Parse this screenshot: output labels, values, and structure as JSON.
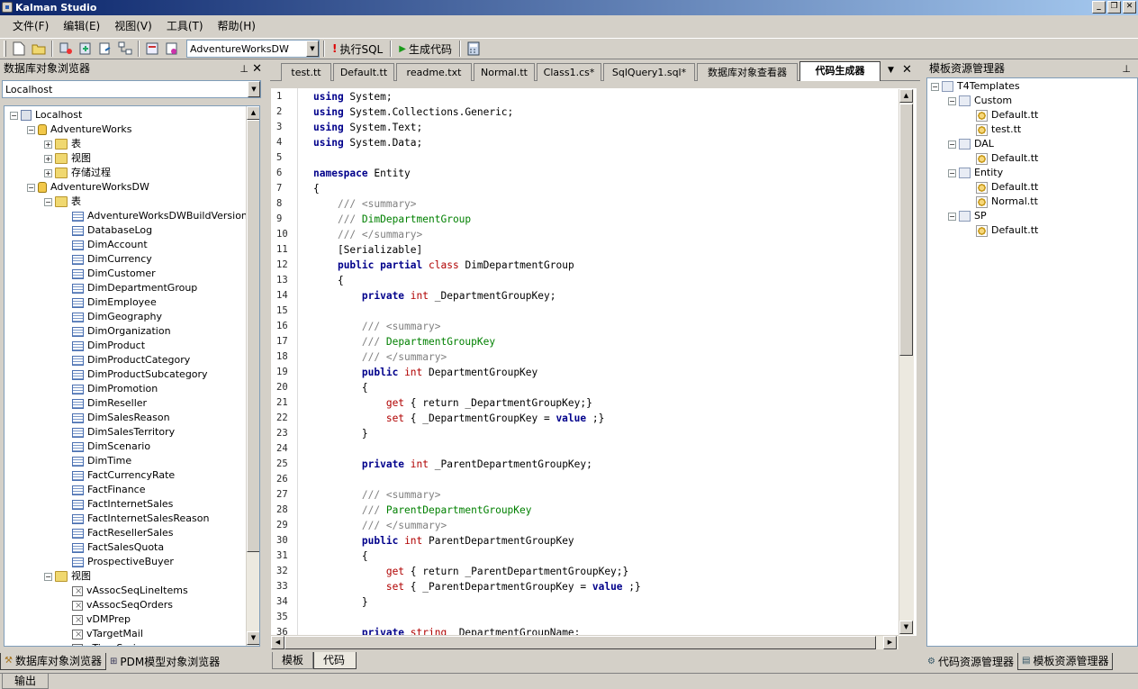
{
  "window": {
    "title": "Kalman Studio"
  },
  "menu": [
    "文件(F)",
    "编辑(E)",
    "视图(V)",
    "工具(T)",
    "帮助(H)"
  ],
  "toolbar": {
    "database": "AdventureWorksDW",
    "exec_sql": "执行SQL",
    "gen_code": "生成代码"
  },
  "left_panel": {
    "title": "数据库对象浏览器",
    "server_combo": "Localhost",
    "tree": [
      {
        "label": "Localhost",
        "level": 0,
        "icon": "server-icon",
        "exp": "-"
      },
      {
        "label": "AdventureWorks",
        "level": 1,
        "icon": "database-icon",
        "exp": "-"
      },
      {
        "label": "表",
        "level": 2,
        "icon": "folder-icon",
        "exp": "+"
      },
      {
        "label": "视图",
        "level": 2,
        "icon": "folder-icon",
        "exp": "+"
      },
      {
        "label": "存储过程",
        "level": 2,
        "icon": "folder-icon",
        "exp": "+"
      },
      {
        "label": "AdventureWorksDW",
        "level": 1,
        "icon": "database-icon",
        "exp": "-"
      },
      {
        "label": "表",
        "level": 2,
        "icon": "folder-icon",
        "exp": "-"
      },
      {
        "label": "AdventureWorksDWBuildVersion",
        "level": 3,
        "icon": "table-icon"
      },
      {
        "label": "DatabaseLog",
        "level": 3,
        "icon": "table-icon"
      },
      {
        "label": "DimAccount",
        "level": 3,
        "icon": "table-icon"
      },
      {
        "label": "DimCurrency",
        "level": 3,
        "icon": "table-icon"
      },
      {
        "label": "DimCustomer",
        "level": 3,
        "icon": "table-icon"
      },
      {
        "label": "DimDepartmentGroup",
        "level": 3,
        "icon": "table-icon"
      },
      {
        "label": "DimEmployee",
        "level": 3,
        "icon": "table-icon"
      },
      {
        "label": "DimGeography",
        "level": 3,
        "icon": "table-icon"
      },
      {
        "label": "DimOrganization",
        "level": 3,
        "icon": "table-icon"
      },
      {
        "label": "DimProduct",
        "level": 3,
        "icon": "table-icon"
      },
      {
        "label": "DimProductCategory",
        "level": 3,
        "icon": "table-icon"
      },
      {
        "label": "DimProductSubcategory",
        "level": 3,
        "icon": "table-icon"
      },
      {
        "label": "DimPromotion",
        "level": 3,
        "icon": "table-icon"
      },
      {
        "label": "DimReseller",
        "level": 3,
        "icon": "table-icon"
      },
      {
        "label": "DimSalesReason",
        "level": 3,
        "icon": "table-icon"
      },
      {
        "label": "DimSalesTerritory",
        "level": 3,
        "icon": "table-icon"
      },
      {
        "label": "DimScenario",
        "level": 3,
        "icon": "table-icon"
      },
      {
        "label": "DimTime",
        "level": 3,
        "icon": "table-icon"
      },
      {
        "label": "FactCurrencyRate",
        "level": 3,
        "icon": "table-icon"
      },
      {
        "label": "FactFinance",
        "level": 3,
        "icon": "table-icon"
      },
      {
        "label": "FactInternetSales",
        "level": 3,
        "icon": "table-icon"
      },
      {
        "label": "FactInternetSalesReason",
        "level": 3,
        "icon": "table-icon"
      },
      {
        "label": "FactResellerSales",
        "level": 3,
        "icon": "table-icon"
      },
      {
        "label": "FactSalesQuota",
        "level": 3,
        "icon": "table-icon"
      },
      {
        "label": "ProspectiveBuyer",
        "level": 3,
        "icon": "table-icon"
      },
      {
        "label": "视图",
        "level": 2,
        "icon": "folder-icon",
        "exp": "-"
      },
      {
        "label": "vAssocSeqLineItems",
        "level": 3,
        "icon": "view-icon"
      },
      {
        "label": "vAssocSeqOrders",
        "level": 3,
        "icon": "view-icon"
      },
      {
        "label": "vDMPrep",
        "level": 3,
        "icon": "view-icon"
      },
      {
        "label": "vTargetMail",
        "level": 3,
        "icon": "view-icon"
      },
      {
        "label": "vTimeSeries",
        "level": 3,
        "icon": "view-icon"
      }
    ],
    "bottom_tabs": [
      "数据库对象浏览器",
      "PDM模型对象浏览器"
    ]
  },
  "doc_tabs": [
    "test.tt",
    "Default.tt",
    "readme.txt",
    "Normal.tt",
    "Class1.cs*",
    "SqlQuery1.sql*",
    "数据库对象查看器",
    "代码生成器"
  ],
  "active_doc_tab": "代码生成器",
  "editor": {
    "lines": [
      [
        [
          "kw",
          "using"
        ],
        [
          "",
          "System;"
        ]
      ],
      [
        [
          "kw",
          "using"
        ],
        [
          "",
          "System.Collections.Generic;"
        ]
      ],
      [
        [
          "kw",
          "using"
        ],
        [
          "",
          "System.Text;"
        ]
      ],
      [
        [
          "kw",
          "using"
        ],
        [
          "",
          "System.Data;"
        ]
      ],
      [],
      [
        [
          "kw",
          "namespace"
        ],
        [
          "",
          "Entity"
        ]
      ],
      [
        [
          "",
          "{"
        ]
      ],
      [
        [
          "",
          "    "
        ],
        [
          "cmtg",
          "/// <"
        ],
        [
          "cmtg",
          "summary"
        ],
        [
          "cmtg",
          ">"
        ]
      ],
      [
        [
          "",
          "    "
        ],
        [
          "cmtg",
          "///"
        ],
        [
          "cmt",
          " DimDepartmentGroup"
        ]
      ],
      [
        [
          "",
          "    "
        ],
        [
          "cmtg",
          "/// </summary>"
        ]
      ],
      [
        [
          "",
          "    [Serializable]"
        ]
      ],
      [
        [
          "",
          "    "
        ],
        [
          "kw",
          "public"
        ],
        [
          "",
          ""
        ],
        [
          "kw",
          "partial"
        ],
        [
          "",
          ""
        ],
        [
          "kwr",
          "class"
        ],
        [
          "",
          "DimDepartmentGroup"
        ]
      ],
      [
        [
          "",
          "    {"
        ]
      ],
      [
        [
          "",
          "        "
        ],
        [
          "kw",
          "private"
        ],
        [
          "",
          ""
        ],
        [
          "kwr",
          "int"
        ],
        [
          "",
          "_DepartmentGroupKey;"
        ]
      ],
      [],
      [
        [
          "",
          "        "
        ],
        [
          "cmtg",
          "/// <summary>"
        ]
      ],
      [
        [
          "",
          "        "
        ],
        [
          "cmtg",
          "///"
        ],
        [
          "cmt",
          " DepartmentGroupKey"
        ]
      ],
      [
        [
          "",
          "        "
        ],
        [
          "cmtg",
          "/// </summary>"
        ]
      ],
      [
        [
          "",
          "        "
        ],
        [
          "kw",
          "public"
        ],
        [
          "",
          ""
        ],
        [
          "kwr",
          "int"
        ],
        [
          "",
          "DepartmentGroupKey"
        ]
      ],
      [
        [
          "",
          "        {"
        ]
      ],
      [
        [
          "",
          "            "
        ],
        [
          "kwr",
          "get"
        ],
        [
          "",
          "{ return _DepartmentGroupKey;}"
        ]
      ],
      [
        [
          "",
          "            "
        ],
        [
          "kwr",
          "set"
        ],
        [
          "",
          "{ _DepartmentGroupKey = "
        ],
        [
          "kw",
          "value"
        ],
        [
          "",
          ";}"
        ]
      ],
      [
        [
          "",
          "        }"
        ]
      ],
      [],
      [
        [
          "",
          "        "
        ],
        [
          "kw",
          "private"
        ],
        [
          "",
          ""
        ],
        [
          "kwr",
          "int"
        ],
        [
          "",
          "_ParentDepartmentGroupKey;"
        ]
      ],
      [],
      [
        [
          "",
          "        "
        ],
        [
          "cmtg",
          "/// <summary>"
        ]
      ],
      [
        [
          "",
          "        "
        ],
        [
          "cmtg",
          "///"
        ],
        [
          "cmt",
          " ParentDepartmentGroupKey"
        ]
      ],
      [
        [
          "",
          "        "
        ],
        [
          "cmtg",
          "/// </summary>"
        ]
      ],
      [
        [
          "",
          "        "
        ],
        [
          "kw",
          "public"
        ],
        [
          "",
          ""
        ],
        [
          "kwr",
          "int"
        ],
        [
          "",
          "ParentDepartmentGroupKey"
        ]
      ],
      [
        [
          "",
          "        {"
        ]
      ],
      [
        [
          "",
          "            "
        ],
        [
          "kwr",
          "get"
        ],
        [
          "",
          "{ return _ParentDepartmentGroupKey;}"
        ]
      ],
      [
        [
          "",
          "            "
        ],
        [
          "kwr",
          "set"
        ],
        [
          "",
          "{ _ParentDepartmentGroupKey = "
        ],
        [
          "kw",
          "value"
        ],
        [
          "",
          ";}"
        ]
      ],
      [
        [
          "",
          "        }"
        ]
      ],
      [],
      [
        [
          "",
          "        "
        ],
        [
          "kw",
          "private"
        ],
        [
          "",
          ""
        ],
        [
          "kwr",
          "string"
        ],
        [
          "",
          "_DepartmentGroupName;"
        ]
      ]
    ],
    "bottom_tabs": [
      "模板",
      "代码"
    ],
    "active_bottom_tab": "代码"
  },
  "right_panel": {
    "title": "模板资源管理器",
    "tree": [
      {
        "label": "T4Templates",
        "level": 0,
        "icon": "template-root-icon",
        "exp": "-"
      },
      {
        "label": "Custom",
        "level": 1,
        "icon": "template-folder-icon",
        "exp": "-"
      },
      {
        "label": "Default.tt",
        "level": 2,
        "icon": "template-file-icon"
      },
      {
        "label": "test.tt",
        "level": 2,
        "icon": "template-file-icon"
      },
      {
        "label": "DAL",
        "level": 1,
        "icon": "template-folder-icon",
        "exp": "-"
      },
      {
        "label": "Default.tt",
        "level": 2,
        "icon": "template-file-icon"
      },
      {
        "label": "Entity",
        "level": 1,
        "icon": "template-folder-icon",
        "exp": "-"
      },
      {
        "label": "Default.tt",
        "level": 2,
        "icon": "template-file-icon"
      },
      {
        "label": "Normal.tt",
        "level": 2,
        "icon": "template-file-icon"
      },
      {
        "label": "SP",
        "level": 1,
        "icon": "template-folder-icon",
        "exp": "-"
      },
      {
        "label": "Default.tt",
        "level": 2,
        "icon": "template-file-icon"
      }
    ],
    "bottom_tabs": [
      "代码资源管理器",
      "模板资源管理器"
    ]
  },
  "status": {
    "output_tab": "输出"
  }
}
